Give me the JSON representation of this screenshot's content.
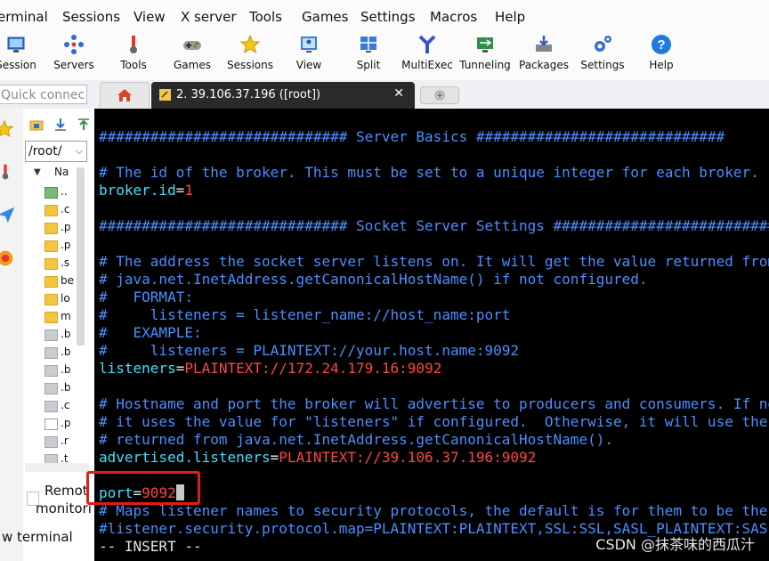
{
  "menubar": {
    "items": [
      "erminal",
      "Sessions",
      "View",
      "X server",
      "Tools",
      "Games",
      "Settings",
      "Macros",
      "Help"
    ]
  },
  "toolbar": {
    "buttons": [
      {
        "label": "Session",
        "icon": "session-icon"
      },
      {
        "label": "Servers",
        "icon": "servers-icon"
      },
      {
        "label": "Tools",
        "icon": "tools-icon"
      },
      {
        "label": "Games",
        "icon": "games-icon"
      },
      {
        "label": "Sessions",
        "icon": "star-icon"
      },
      {
        "label": "View",
        "icon": "view-icon"
      },
      {
        "label": "Split",
        "icon": "split-icon"
      },
      {
        "label": "MultiExec",
        "icon": "multiexec-icon"
      },
      {
        "label": "Tunneling",
        "icon": "tunneling-icon"
      },
      {
        "label": "Packages",
        "icon": "packages-icon"
      },
      {
        "label": "Settings",
        "icon": "settings-icon"
      },
      {
        "label": "Help",
        "icon": "help-icon"
      }
    ]
  },
  "quick_connect": {
    "placeholder": "Quick connec"
  },
  "tabs": {
    "home_icon": "home-icon",
    "session_title": "2. 39.106.37.196 ([root])",
    "close_glyph": "✕"
  },
  "sftp": {
    "path": "/root/",
    "column_header": "Na",
    "files": [
      {
        "name": "..",
        "type": "up"
      },
      {
        "name": ".c",
        "type": "folder"
      },
      {
        "name": ".p",
        "type": "folder"
      },
      {
        "name": ".p",
        "type": "folder"
      },
      {
        "name": ".s",
        "type": "folder"
      },
      {
        "name": "be",
        "type": "folder"
      },
      {
        "name": "lo",
        "type": "folder"
      },
      {
        "name": "m",
        "type": "folder"
      },
      {
        "name": ".b",
        "type": "gray"
      },
      {
        "name": ".b",
        "type": "gray"
      },
      {
        "name": ".b",
        "type": "gray"
      },
      {
        "name": ".b",
        "type": "gray"
      },
      {
        "name": ".c",
        "type": "gray"
      },
      {
        "name": ".p",
        "type": "doc"
      },
      {
        "name": ".r",
        "type": "gray"
      },
      {
        "name": ".t",
        "type": "gray"
      }
    ],
    "remote_line1": "Remot",
    "remote_line2": "monitori",
    "follow_label": "w terminal"
  },
  "terminal": {
    "lines": [
      [
        {
          "t": "############################# Server Basics #############################",
          "c": "blue"
        }
      ],
      [
        {
          "t": "",
          "c": "blue"
        }
      ],
      [
        {
          "t": "# The id of the broker. This must be set to a unique integer for each broker.",
          "c": "blue"
        }
      ],
      [
        {
          "t": "broker.id",
          "c": "cyan"
        },
        {
          "t": "=",
          "c": "white"
        },
        {
          "t": "1",
          "c": "red"
        }
      ],
      [
        {
          "t": "",
          "c": "blue"
        }
      ],
      [
        {
          "t": "############################# Socket Server Settings #############################",
          "c": "blue"
        }
      ],
      [
        {
          "t": "",
          "c": "blue"
        }
      ],
      [
        {
          "t": "# The address the socket server listens on. It will get the value returned from",
          "c": "blue"
        }
      ],
      [
        {
          "t": "# java.net.InetAddress.getCanonicalHostName() if not configured.",
          "c": "blue"
        }
      ],
      [
        {
          "t": "#   FORMAT:",
          "c": "blue"
        }
      ],
      [
        {
          "t": "#     listeners = listener_name://host_name:port",
          "c": "blue"
        }
      ],
      [
        {
          "t": "#   EXAMPLE:",
          "c": "blue"
        }
      ],
      [
        {
          "t": "#     listeners = PLAINTEXT://your.host.name:9092",
          "c": "blue"
        }
      ],
      [
        {
          "t": "listeners",
          "c": "cyan"
        },
        {
          "t": "=",
          "c": "white"
        },
        {
          "t": "PLAINTEXT://172.24.179.16:9092",
          "c": "red"
        }
      ],
      [
        {
          "t": "",
          "c": "blue"
        }
      ],
      [
        {
          "t": "# Hostname and port the broker will advertise to producers and consumers. If not set,",
          "c": "blue"
        }
      ],
      [
        {
          "t": "# it uses the value for \"listeners\" if configured.  Otherwise, it will use the value",
          "c": "blue"
        }
      ],
      [
        {
          "t": "# returned from java.net.InetAddress.getCanonicalHostName().",
          "c": "blue"
        }
      ],
      [
        {
          "t": "advertised.listeners",
          "c": "cyan"
        },
        {
          "t": "=",
          "c": "white"
        },
        {
          "t": "PLAINTEXT://39.106.37.196:9092",
          "c": "red"
        }
      ],
      [
        {
          "t": "",
          "c": "blue"
        }
      ],
      [
        {
          "t": "port",
          "c": "cyan"
        },
        {
          "t": "=",
          "c": "white"
        },
        {
          "t": "9092",
          "c": "red"
        }
      ],
      [
        {
          "t": "# Maps listener names to security protocols, the default is for them to be the same.",
          "c": "blue"
        }
      ],
      [
        {
          "t": "#listener.security.protocol.map=PLAINTEXT:PLAINTEXT,SSL:SSL,SASL_PLAINTEXT:SASL_PLAINTEXT",
          "c": "blue"
        }
      ],
      [
        {
          "t": "-- INSERT --",
          "c": "white"
        }
      ]
    ],
    "cursor_line": 20
  },
  "watermark": "CSDN @抹茶味的西瓜汁",
  "colors": {
    "terminal_bg": "#000000",
    "comment": "#4a8fff",
    "key": "#3ee0ff",
    "value": "#ff4545",
    "highlight_box": "#e31a1a"
  }
}
